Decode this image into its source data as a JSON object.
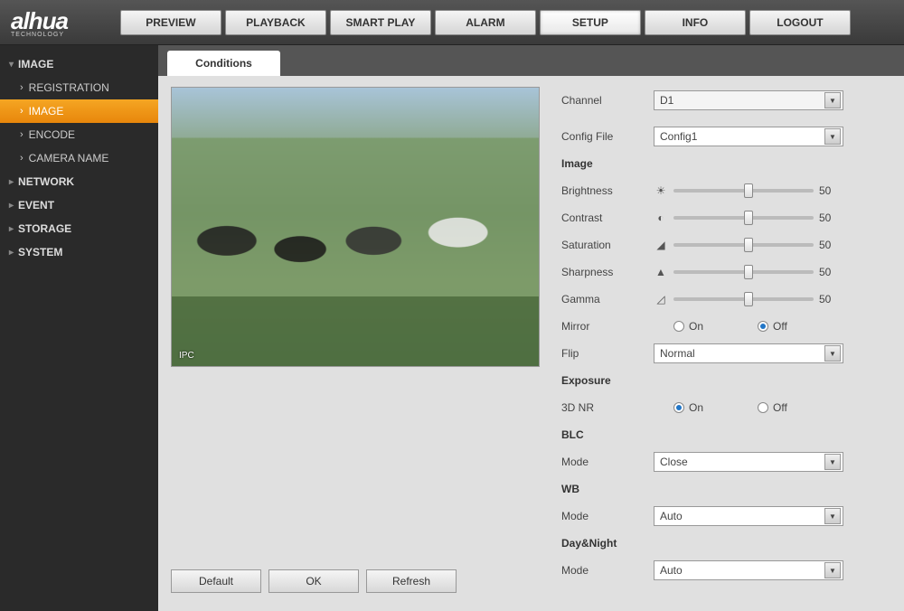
{
  "brand": {
    "name": "alhua",
    "sub": "TECHNOLOGY"
  },
  "nav": [
    "PREVIEW",
    "PLAYBACK",
    "SMART PLAY",
    "ALARM",
    "SETUP",
    "INFO",
    "LOGOUT"
  ],
  "navActive": "SETUP",
  "sidebar": {
    "groups": [
      {
        "label": "IMAGE",
        "expanded": true,
        "items": [
          "REGISTRATION",
          "IMAGE",
          "ENCODE",
          "CAMERA NAME"
        ],
        "active": "IMAGE"
      },
      {
        "label": "NETWORK"
      },
      {
        "label": "EVENT"
      },
      {
        "label": "STORAGE"
      },
      {
        "label": "SYSTEM"
      }
    ]
  },
  "pageTab": "Conditions",
  "preview": {
    "ipc": "IPC"
  },
  "settings": {
    "channel": {
      "label": "Channel",
      "value": "D1"
    },
    "configFile": {
      "label": "Config File",
      "value": "Config1"
    },
    "sectionImage": "Image",
    "brightness": {
      "label": "Brightness",
      "value": 50
    },
    "contrast": {
      "label": "Contrast",
      "value": 50
    },
    "saturation": {
      "label": "Saturation",
      "value": 50
    },
    "sharpness": {
      "label": "Sharpness",
      "value": 50
    },
    "gamma": {
      "label": "Gamma",
      "value": 50
    },
    "mirror": {
      "label": "Mirror",
      "on": "On",
      "off": "Off",
      "value": "Off"
    },
    "flip": {
      "label": "Flip",
      "value": "Normal"
    },
    "sectionExposure": "Exposure",
    "nr3d": {
      "label": "3D NR",
      "on": "On",
      "off": "Off",
      "value": "On"
    },
    "sectionBLC": "BLC",
    "blcMode": {
      "label": "Mode",
      "value": "Close"
    },
    "sectionWB": "WB",
    "wbMode": {
      "label": "Mode",
      "value": "Auto"
    },
    "sectionDN": "Day&Night",
    "dnMode": {
      "label": "Mode",
      "value": "Auto"
    }
  },
  "buttons": {
    "default": "Default",
    "ok": "OK",
    "refresh": "Refresh"
  }
}
